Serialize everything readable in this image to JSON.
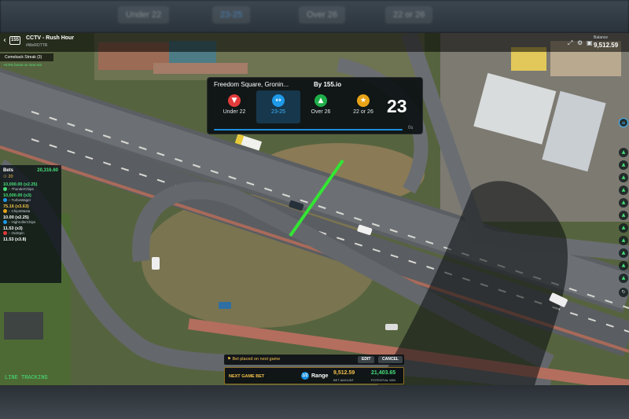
{
  "background_tabs": [
    "Under 22",
    "23-25",
    "Over 26",
    "22 or 26"
  ],
  "header": {
    "back_icon": "back-arrow-icon",
    "logo_text": "155",
    "title": "CCTV - Rush Hour",
    "subtitle": "#WeROTTR",
    "balance_label": "Balance",
    "balance_value": "9,512.59",
    "icons": [
      "fullscreen-icon",
      "settings-icon",
      "wallet-icon"
    ]
  },
  "streak": {
    "label": "Comeback Streak (3)",
    "note": "+0.5% boost on next win"
  },
  "game_panel": {
    "location": "Freedom Square, Gronin...",
    "by": "By 155.io",
    "options": [
      {
        "label": "Under 22",
        "icon": "down-triangle-icon",
        "color": "#e23b3b",
        "selected": false
      },
      {
        "label": "23-25",
        "icon": "range-arrows-icon",
        "color": "#1e9ae8",
        "selected": true
      },
      {
        "label": "Over 26",
        "icon": "up-triangle-icon",
        "color": "#1fae4a",
        "selected": false
      },
      {
        "label": "22 or 26",
        "icon": "star-icon",
        "color": "#e8a417",
        "selected": false
      }
    ],
    "count": "23",
    "seconds_label": "0s"
  },
  "bets": {
    "header_label": "Bets",
    "header_value": "20,316.60",
    "count": "20",
    "rows": [
      {
        "amount": "10,000.00 (x2.25)",
        "name": "ThunderChips",
        "tone": "g",
        "color": "#46e07a"
      },
      {
        "amount": "10,000.00 (x3)",
        "name": "TurboWager",
        "tone": "g",
        "color": "#1e9ae8"
      },
      {
        "amount": "75.16 (x3.63)",
        "name": "ChipsMasta",
        "tone": "y",
        "color": "#e8a417"
      },
      {
        "amount": "10.00 (x2.25)",
        "name": "HighrollerChips",
        "tone": "w",
        "color": "#1e9ae8"
      },
      {
        "amount": "11.53 (x3)",
        "name": "OutSpin",
        "tone": "w",
        "color": "#e23b3b"
      },
      {
        "amount": "11.53 (x3.8)",
        "name": "",
        "tone": "w",
        "color": "#e23b3b"
      }
    ]
  },
  "line_tracking": "LINE TRACKING",
  "bet_strip": {
    "text": "Bet placed on next game",
    "edit": "EDIT",
    "cancel": "CANCEL"
  },
  "next_bar": {
    "label": "NEXT GAME BET",
    "range_icon_text": "1/2",
    "range_label": "Range",
    "bet_amount": "9,512.59",
    "bet_amount_caption": "BET AMOUNT",
    "potential_win": "21,403.65",
    "potential_win_caption": "POTENTIAL WIN"
  },
  "right_rail": {
    "count_icons": 11,
    "top_icon": "info-icon",
    "bottom_icon": "refresh-icon"
  },
  "colors": {
    "accent_blue": "#1e9ae8",
    "accent_green": "#46e07a",
    "accent_gold": "#f3c34b",
    "tracking_line": "#33e633"
  }
}
